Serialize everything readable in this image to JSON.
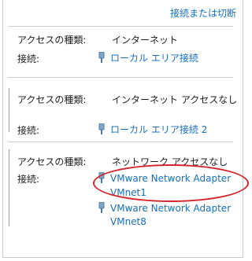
{
  "header": {
    "connect_link": "接続または切断"
  },
  "networks": [
    {
      "access_label": "アクセスの種類:",
      "access_value": "インターネット",
      "connection_label": "接続:",
      "connections": [
        "ローカル エリア接続"
      ]
    },
    {
      "access_label": "アクセスの種類:",
      "access_value": "インターネット アクセスなし",
      "connection_label": "接続:",
      "connections": [
        "ローカル エリア接続 2"
      ]
    },
    {
      "access_label": "アクセスの種類:",
      "access_value": "ネットワーク アクセスなし",
      "connection_label": "接続:",
      "connections": [
        {
          "line1": "VMware Network Adapter",
          "line2": "VMnet1"
        },
        {
          "line1": "VMware Network Adapter",
          "line2": "VMnet8"
        }
      ]
    }
  ],
  "colors": {
    "link": "#1a6fb8",
    "highlight": "#d4222a"
  },
  "icons": {
    "connection": "network-adapter-icon"
  }
}
